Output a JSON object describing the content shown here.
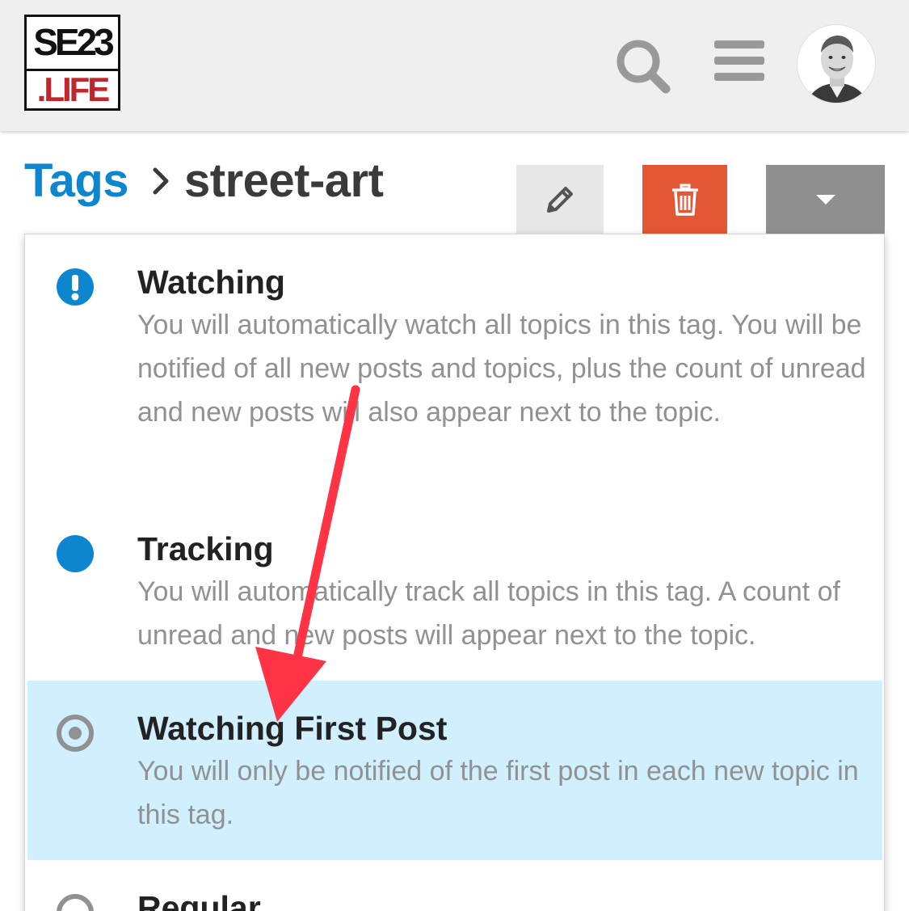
{
  "header": {
    "logo_top": "SE23",
    "logo_bottom": ".LIFE",
    "search_icon": "search-icon",
    "menu_icon": "hamburger-menu-icon",
    "avatar_icon": "user-avatar"
  },
  "breadcrumb": {
    "root": "Tags",
    "separator_icon": "chevron-right-icon",
    "current": "street-art"
  },
  "toolbar": {
    "edit_icon": "pencil-icon",
    "delete_icon": "trash-icon",
    "notification_icon": "caret-down-icon"
  },
  "notification_menu": {
    "options": [
      {
        "title": "Watching",
        "description": "You will automatically watch all topics in this tag. You will be notified of all new posts and topics, plus the count of unread and new posts will also appear next to the topic.",
        "icon": "exclamation-circle-icon",
        "selected": false
      },
      {
        "title": "Tracking",
        "description": "You will automatically track all topics in this tag. A count of unread and new posts will appear next to the topic.",
        "icon": "filled-circle-icon",
        "selected": false
      },
      {
        "title": "Watching First Post",
        "description": "You will only be notified of the first post in each new topic in this tag.",
        "icon": "dot-circle-icon",
        "selected": true
      },
      {
        "title": "Regular",
        "description": "",
        "icon": "empty-circle-icon",
        "selected": false
      }
    ]
  },
  "annotation": {
    "arrow_color": "#ff3346"
  },
  "colors": {
    "link_blue": "#0e86cf",
    "delete_red": "#e45735",
    "selected_bg": "#d1f0ff",
    "header_bg": "#efefef"
  }
}
